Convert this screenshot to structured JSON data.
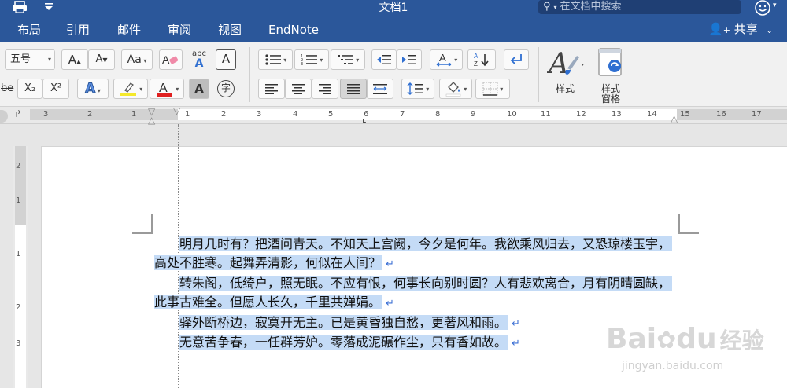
{
  "window": {
    "title": "文档1"
  },
  "search": {
    "placeholder": "在文档中搜索"
  },
  "tabs": [
    "布局",
    "引用",
    "邮件",
    "审阅",
    "视图",
    "EndNote"
  ],
  "share_label": "共享",
  "ribbon": {
    "font_size": "五号",
    "grow_font": "A",
    "shrink_font": "A",
    "change_case": "Aa",
    "abc_label": "abc",
    "subscript": "X₂",
    "superscript": "X²",
    "text_effects": "A",
    "font_color": "A",
    "char_shading": "A",
    "enclose_char": "字",
    "styles_label": "样式",
    "styles_pane_label_1": "样式",
    "styles_pane_label_2": "窗格"
  },
  "ruler": {
    "h_numbers": [
      "3",
      "2",
      "1",
      "1",
      "2",
      "3",
      "4",
      "5",
      "6",
      "7",
      "8",
      "9",
      "10",
      "11",
      "12",
      "13",
      "14",
      "15",
      "16",
      "17"
    ],
    "v_numbers": [
      "2",
      "1",
      "1",
      "2",
      "3"
    ]
  },
  "document": {
    "lines": [
      "明月几时有？把酒问青天。不知天上宫阙，今夕是何年。我欲乘风归去，又恐琼楼玉宇，",
      "高处不胜寒。起舞弄清影，何似在人间？",
      "转朱阁，低绮户，照无眠。不应有恨，何事长向别时圆？人有悲欢离合，月有阴晴圆缺，",
      "此事古难全。但愿人长久，千里共婵娟。",
      "驿外断桥边，寂寞开无主。已是黄昏独自愁，更著风和雨。",
      "无意苦争春，一任群芳妒。零落成泥碾作尘，只有香如故。"
    ],
    "return_mark": "↵"
  },
  "watermark": {
    "brand": "Bai",
    "brand_cn": "经验",
    "url": "jingyan.baidu.com"
  },
  "colors": {
    "titlebar": "#2b579a",
    "highlight": "#c4dbf6",
    "font_color_bar": "#e02020",
    "highlight_bar": "#f5e92b"
  }
}
